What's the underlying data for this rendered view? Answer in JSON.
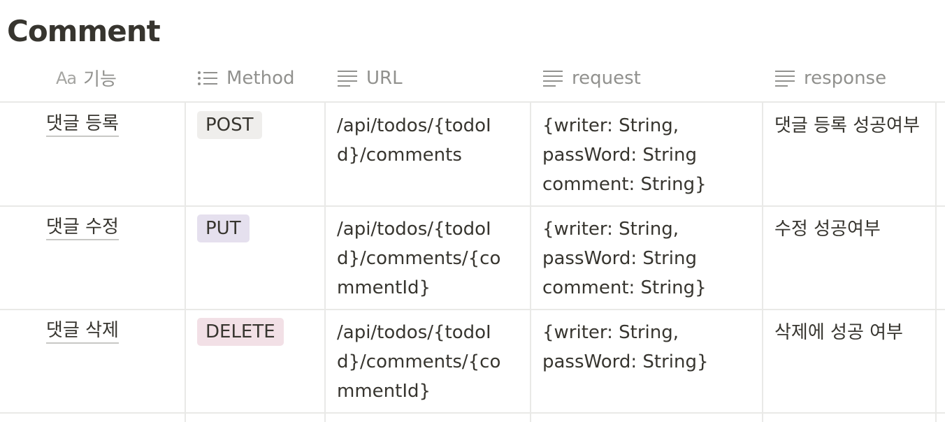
{
  "page": {
    "title": "Comment"
  },
  "columns": [
    {
      "key": "name",
      "icon": "title-aa-icon",
      "icon_text": "Aa",
      "label": "기능"
    },
    {
      "key": "method",
      "icon": "list-icon",
      "label": "Method"
    },
    {
      "key": "url",
      "icon": "text-lines-icon",
      "label": "URL"
    },
    {
      "key": "request",
      "icon": "text-lines-icon",
      "label": "request"
    },
    {
      "key": "response",
      "icon": "text-lines-icon",
      "label": "response"
    }
  ],
  "rows": [
    {
      "name": "댓글 등록",
      "method": "POST",
      "method_color": "#efeeec",
      "url": "/api/todos/{todoId}/comments",
      "request": [
        "{writer: String,",
        "passWord: String",
        "comment: String}"
      ],
      "response": "댓글 등록 성공여부"
    },
    {
      "name": "댓글 수정",
      "method": "PUT",
      "method_color": "#e5e0ee",
      "url": "/api/todos/{todoId}/comments/{commentId}",
      "request": [
        "{writer: String,",
        "passWord: String",
        "comment: String}"
      ],
      "response": "수정 성공여부"
    },
    {
      "name": "댓글 삭제",
      "method": "DELETE",
      "method_color": "#f2e0e6",
      "url": "/api/todos/{todoId}/comments/{commentId}",
      "request": [
        "{writer: String,",
        "passWord: String}"
      ],
      "response": "삭제에 성공 여부"
    }
  ]
}
